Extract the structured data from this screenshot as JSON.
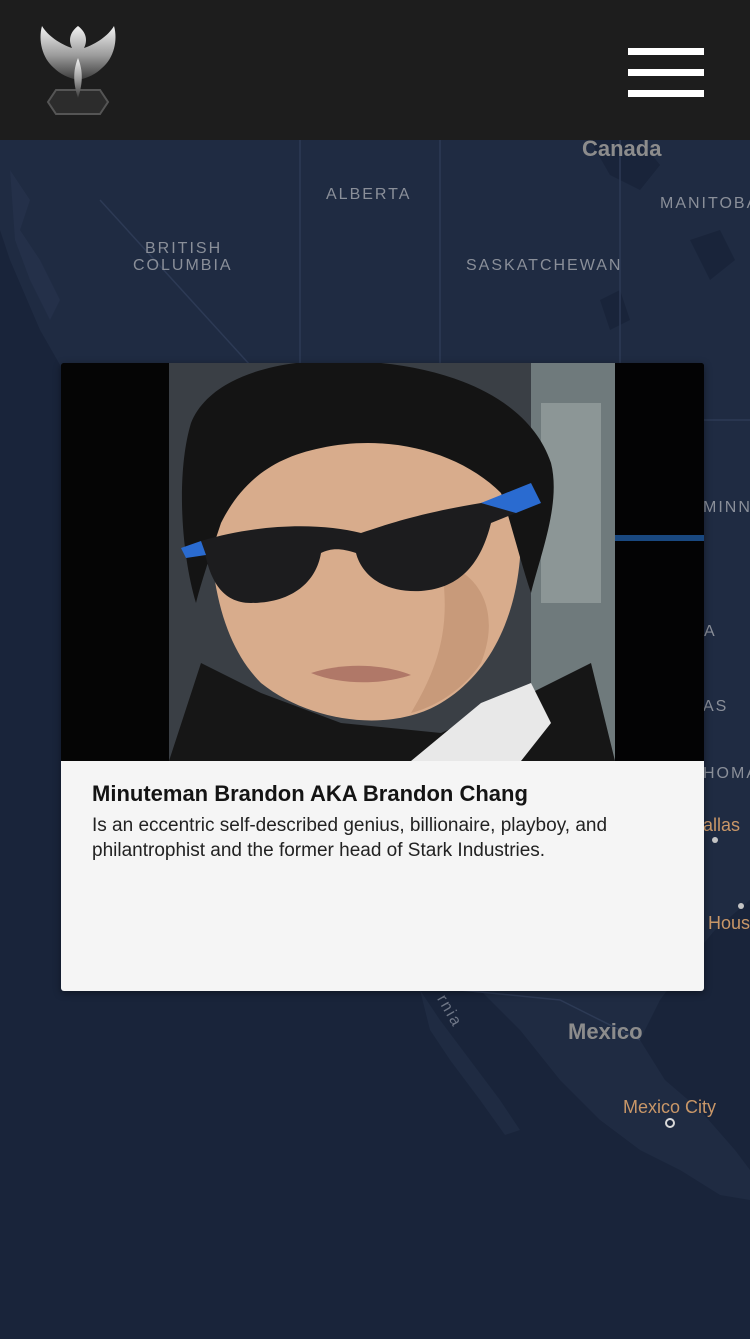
{
  "header": {
    "logo_icon": "phoenix-logo-icon",
    "menu_icon": "hamburger-menu-icon"
  },
  "map": {
    "labels": {
      "canada": "Canada",
      "alberta": "ALBERTA",
      "manitoba": "MANITOBA",
      "british_columbia_1": "BRITISH",
      "british_columbia_2": "COLUMBIA",
      "saskatchewan": "SASKATCHEWAN",
      "minnesota_partial": "MINN",
      "a_partial": "A",
      "as_partial": "AS",
      "oklahoma_partial": "HOMA",
      "dallas_partial": "allas",
      "houston_partial": "Hous",
      "california_partial": "rnia",
      "mexico": "Mexico",
      "mexico_city": "Mexico City"
    }
  },
  "card": {
    "title": "Minuteman Brandon AKA Brandon Chang",
    "description": "Is an eccentric self-described genius, billionaire, playboy, and philantrophist and the former head of Stark Industries."
  }
}
